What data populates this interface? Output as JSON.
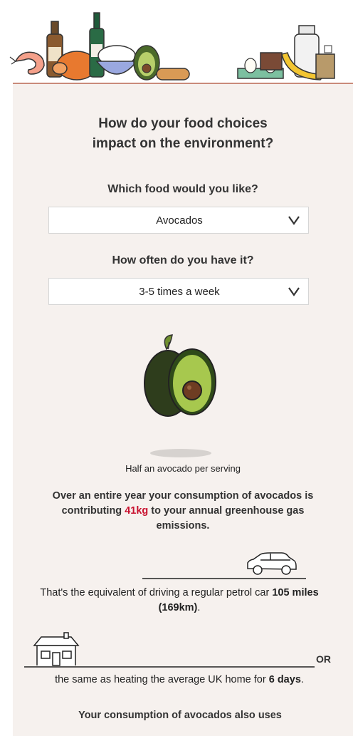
{
  "title": {
    "line1": "How do your food choices",
    "line2": "impact on the environment?"
  },
  "food_question": "Which food would you like?",
  "food_select": {
    "value": "Avocados"
  },
  "frequency_question": "How often do you have it?",
  "frequency_select": {
    "value": "3-5 times a week"
  },
  "serving_text": "Half an avocado per serving",
  "summary": {
    "before": "Over an entire year your consumption of avocados is contributing ",
    "amount": "41kg",
    "after": " to your annual greenhouse gas emissions."
  },
  "car": {
    "before": "That's the equivalent of driving a regular petrol car ",
    "distance": "105 miles (169km)",
    "after": "."
  },
  "or_label": "OR",
  "house": {
    "before": "the same as heating the average UK home for ",
    "days": "6 days",
    "after": "."
  },
  "bottom_text": "Your consumption of avocados also uses",
  "colors": {
    "highlight": "#c8102e",
    "panel": "#f6f1ee",
    "accent_line": "#c98a7a"
  },
  "icons": [
    "food-banner-illustration",
    "avocado-illustration",
    "car-icon",
    "house-icon",
    "chevron-down-icon"
  ]
}
